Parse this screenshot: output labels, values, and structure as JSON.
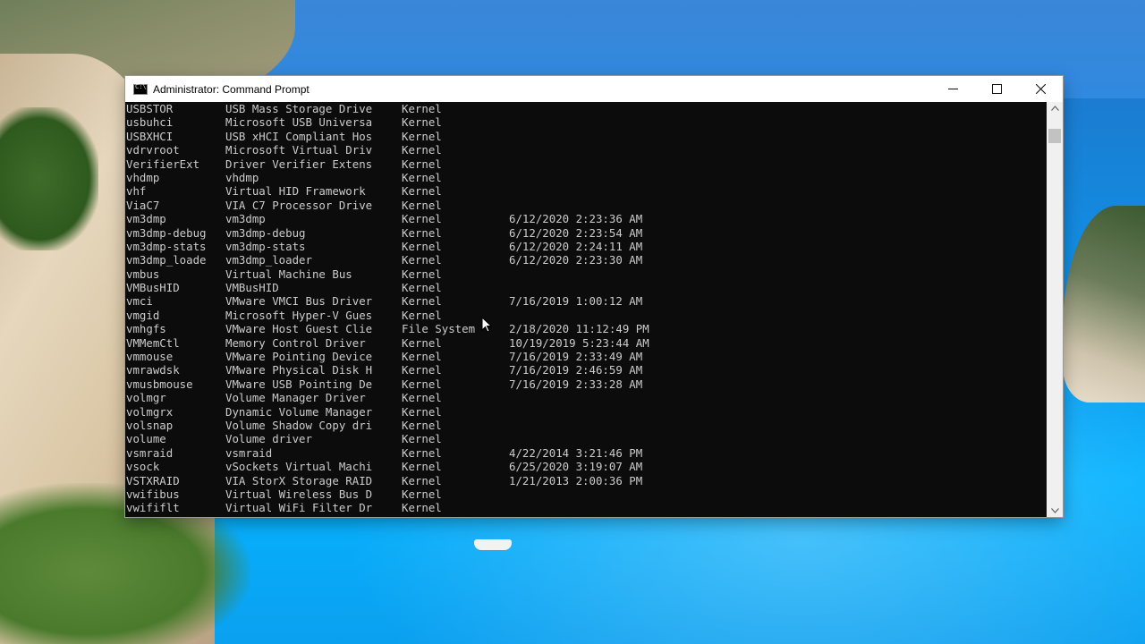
{
  "window": {
    "title": "Administrator: Command Prompt",
    "minimize_icon": "minimize-icon",
    "maximize_icon": "maximize-icon",
    "close_icon": "close-icon"
  },
  "console": {
    "rows": [
      {
        "module": "USBSTOR",
        "display": "USB Mass Storage Drive",
        "type": "Kernel",
        "date": ""
      },
      {
        "module": "usbuhci",
        "display": "Microsoft USB Universa",
        "type": "Kernel",
        "date": ""
      },
      {
        "module": "USBXHCI",
        "display": "USB xHCI Compliant Hos",
        "type": "Kernel",
        "date": ""
      },
      {
        "module": "vdrvroot",
        "display": "Microsoft Virtual Driv",
        "type": "Kernel",
        "date": ""
      },
      {
        "module": "VerifierExt",
        "display": "Driver Verifier Extens",
        "type": "Kernel",
        "date": ""
      },
      {
        "module": "vhdmp",
        "display": "vhdmp",
        "type": "Kernel",
        "date": ""
      },
      {
        "module": "vhf",
        "display": "Virtual HID Framework",
        "type": "Kernel",
        "date": ""
      },
      {
        "module": "ViaC7",
        "display": "VIA C7 Processor Drive",
        "type": "Kernel",
        "date": ""
      },
      {
        "module": "vm3dmp",
        "display": "vm3dmp",
        "type": "Kernel",
        "date": "6/12/2020 2:23:36 AM"
      },
      {
        "module": "vm3dmp-debug",
        "display": "vm3dmp-debug",
        "type": "Kernel",
        "date": "6/12/2020 2:23:54 AM"
      },
      {
        "module": "vm3dmp-stats",
        "display": "vm3dmp-stats",
        "type": "Kernel",
        "date": "6/12/2020 2:24:11 AM"
      },
      {
        "module": "vm3dmp_loade",
        "display": "vm3dmp_loader",
        "type": "Kernel",
        "date": "6/12/2020 2:23:30 AM"
      },
      {
        "module": "vmbus",
        "display": "Virtual Machine Bus",
        "type": "Kernel",
        "date": ""
      },
      {
        "module": "VMBusHID",
        "display": "VMBusHID",
        "type": "Kernel",
        "date": ""
      },
      {
        "module": "vmci",
        "display": "VMware VMCI Bus Driver",
        "type": "Kernel",
        "date": "7/16/2019 1:00:12 AM"
      },
      {
        "module": "vmgid",
        "display": "Microsoft Hyper-V Gues",
        "type": "Kernel",
        "date": ""
      },
      {
        "module": "vmhgfs",
        "display": "VMware Host Guest Clie",
        "type": "File System",
        "date": "2/18/2020 11:12:49 PM"
      },
      {
        "module": "VMMemCtl",
        "display": "Memory Control Driver",
        "type": "Kernel",
        "date": "10/19/2019 5:23:44 AM"
      },
      {
        "module": "vmmouse",
        "display": "VMware Pointing Device",
        "type": "Kernel",
        "date": "7/16/2019 2:33:49 AM"
      },
      {
        "module": "vmrawdsk",
        "display": "VMware Physical Disk H",
        "type": "Kernel",
        "date": "7/16/2019 2:46:59 AM"
      },
      {
        "module": "vmusbmouse",
        "display": "VMware USB Pointing De",
        "type": "Kernel",
        "date": "7/16/2019 2:33:28 AM"
      },
      {
        "module": "volmgr",
        "display": "Volume Manager Driver",
        "type": "Kernel",
        "date": ""
      },
      {
        "module": "volmgrx",
        "display": "Dynamic Volume Manager",
        "type": "Kernel",
        "date": ""
      },
      {
        "module": "volsnap",
        "display": "Volume Shadow Copy dri",
        "type": "Kernel",
        "date": ""
      },
      {
        "module": "volume",
        "display": "Volume driver",
        "type": "Kernel",
        "date": ""
      },
      {
        "module": "vsmraid",
        "display": "vsmraid",
        "type": "Kernel",
        "date": "4/22/2014 3:21:46 PM"
      },
      {
        "module": "vsock",
        "display": "vSockets Virtual Machi",
        "type": "Kernel",
        "date": "6/25/2020 3:19:07 AM"
      },
      {
        "module": "VSTXRAID",
        "display": "VIA StorX Storage RAID",
        "type": "Kernel",
        "date": "1/21/2013 2:00:36 PM"
      },
      {
        "module": "vwifibus",
        "display": "Virtual Wireless Bus D",
        "type": "Kernel",
        "date": ""
      },
      {
        "module": "vwififlt",
        "display": "Virtual WiFi Filter Dr",
        "type": "Kernel",
        "date": ""
      }
    ]
  },
  "colors": {
    "console_bg": "#0c0c0c",
    "console_text": "#cccccc",
    "titlebar_bg": "#ffffff"
  }
}
